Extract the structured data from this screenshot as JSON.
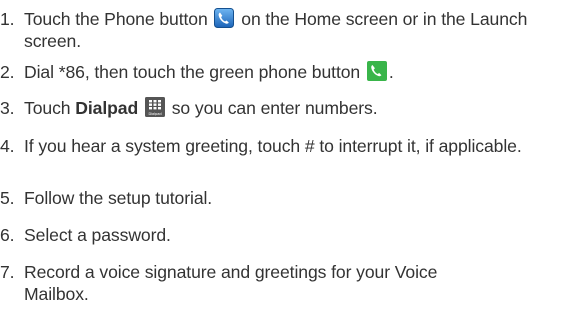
{
  "steps": [
    {
      "num": "1.",
      "text_before": "Touch the Phone button",
      "icon": "phone-app-icon",
      "text_after": "on the Home screen or in the Launch screen."
    },
    {
      "num": "2.",
      "text_before": "Dial *86, then touch the green phone button",
      "icon": "green-call-icon",
      "text_after": "."
    },
    {
      "num": "3.",
      "text_before": "Touch",
      "bold": "Dialpad",
      "icon": "dialpad-icon",
      "icon_caption": "Dialpad",
      "text_after": "so you can enter numbers."
    },
    {
      "num": "4.",
      "text": "If you hear a system greeting, touch # to interrupt it, if applicable."
    },
    {
      "num": "5.",
      "text": "Follow the setup tutorial."
    },
    {
      "num": "6.",
      "text": "Select a password."
    },
    {
      "num": "7.",
      "text": "Record a voice signature and greetings for your Voice Mailbox."
    }
  ],
  "colors": {
    "text": "#333333",
    "phone_icon_bg": "#2a7fd4",
    "green_call_bg": "#39b54a",
    "dialpad_bg": "#555555"
  }
}
